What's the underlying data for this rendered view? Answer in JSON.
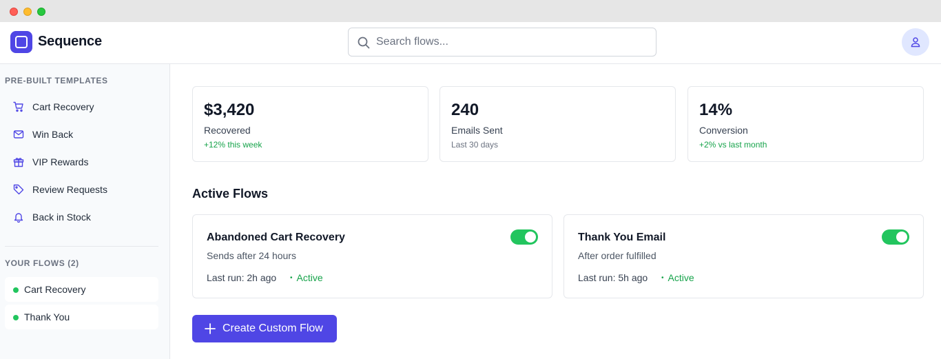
{
  "app": {
    "brand": "Sequence"
  },
  "search": {
    "placeholder": "Search flows..."
  },
  "sidebar": {
    "templates_heading": "PRE-BUILT TEMPLATES",
    "templates": [
      {
        "label": "Cart Recovery",
        "icon": "cart-icon"
      },
      {
        "label": "Win Back",
        "icon": "mail-icon"
      },
      {
        "label": "VIP Rewards",
        "icon": "gift-icon"
      },
      {
        "label": "Review Requests",
        "icon": "tag-icon"
      },
      {
        "label": "Back in Stock",
        "icon": "bell-icon"
      }
    ],
    "flows_heading": "YOUR FLOWS (2)",
    "flows": [
      {
        "label": "Cart Recovery",
        "status_color": "#22c55e"
      },
      {
        "label": "Thank You",
        "status_color": "#22c55e"
      }
    ]
  },
  "stats": [
    {
      "value": "$3,420",
      "label": "Recovered",
      "sub": "+12% this week"
    },
    {
      "value": "240",
      "label": "Emails Sent",
      "sub": "Last 30 days"
    },
    {
      "value": "14%",
      "label": "Conversion",
      "sub": "+2% vs last month"
    }
  ],
  "active_flows": {
    "title": "Active Flows",
    "items": [
      {
        "name": "Abandoned Cart Recovery",
        "description": "Sends after 24 hours",
        "last_run": "Last run: 2h ago",
        "status": "Active",
        "enabled": true
      },
      {
        "name": "Thank You Email",
        "description": "After order fulfilled",
        "last_run": "Last run: 5h ago",
        "status": "Active",
        "enabled": true
      }
    ]
  },
  "actions": {
    "create_label": "Create Custom Flow"
  },
  "colors": {
    "accent": "#4f46e5",
    "success": "#22c55e",
    "positive_text": "#16a34a"
  }
}
